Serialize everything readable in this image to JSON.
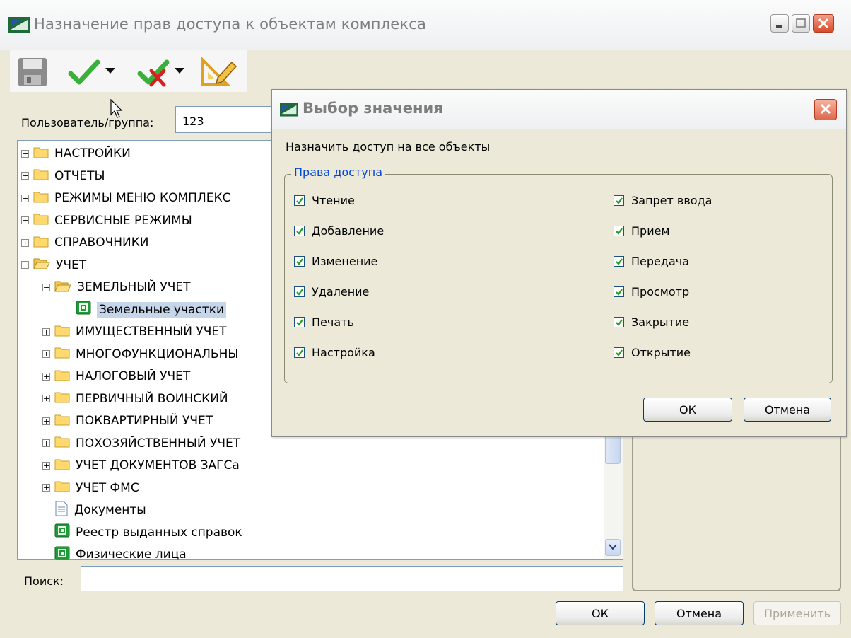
{
  "main_window": {
    "title": "Назначение прав доступа к объектам комплекса",
    "user_group_label": "Пользователь/группа:",
    "user_group_value": "123",
    "search_label": "Поиск:",
    "search_value": "",
    "buttons": {
      "ok": "ОК",
      "cancel": "Отмена",
      "apply": "Применить"
    }
  },
  "tree": [
    {
      "label": "НАСТРОЙКИ",
      "level": 0,
      "icon": "folder-icon",
      "expander": "+"
    },
    {
      "label": "ОТЧЕТЫ",
      "level": 0,
      "icon": "folder-icon",
      "expander": "+"
    },
    {
      "label": "РЕЖИМЫ МЕНЮ КОМПЛЕКС",
      "level": 0,
      "icon": "folder-icon",
      "expander": "+"
    },
    {
      "label": "СЕРВИСНЫЕ РЕЖИМЫ",
      "level": 0,
      "icon": "folder-icon",
      "expander": "+"
    },
    {
      "label": "СПРАВОЧНИКИ",
      "level": 0,
      "icon": "folder-icon",
      "expander": "+"
    },
    {
      "label": "УЧЕТ",
      "level": 0,
      "icon": "folder-open-icon",
      "expander": "−"
    },
    {
      "label": "ЗЕМЕЛЬНЫЙ УЧЕТ",
      "level": 1,
      "icon": "folder-open-icon",
      "expander": "−"
    },
    {
      "label": "Земельные участки",
      "level": 2,
      "icon": "table-icon",
      "expander": "",
      "selected": true
    },
    {
      "label": "ИМУЩЕСТВЕННЫЙ УЧЕТ",
      "level": 1,
      "icon": "folder-icon",
      "expander": "+"
    },
    {
      "label": "МНОГОФУНКЦИОНАЛЬНЫ",
      "level": 1,
      "icon": "folder-icon",
      "expander": "+"
    },
    {
      "label": "НАЛОГОВЫЙ УЧЕТ",
      "level": 1,
      "icon": "folder-icon",
      "expander": "+"
    },
    {
      "label": "ПЕРВИЧНЫЙ ВОИНСКИЙ",
      "level": 1,
      "icon": "folder-icon",
      "expander": "+"
    },
    {
      "label": "ПОКВАРТИРНЫЙ УЧЕТ",
      "level": 1,
      "icon": "folder-icon",
      "expander": "+"
    },
    {
      "label": "ПОХОЗЯЙСТВЕННЫЙ УЧЕТ",
      "level": 1,
      "icon": "folder-icon",
      "expander": "+"
    },
    {
      "label": "УЧЕТ ДОКУМЕНТОВ ЗАГСа",
      "level": 1,
      "icon": "folder-icon",
      "expander": "+"
    },
    {
      "label": "УЧЕТ ФМС",
      "level": 1,
      "icon": "folder-icon",
      "expander": "+"
    },
    {
      "label": "Документы",
      "level": 1,
      "icon": "document-icon",
      "expander": ""
    },
    {
      "label": "Реестр выданных справок",
      "level": 1,
      "icon": "table-icon",
      "expander": ""
    },
    {
      "label": "Физические лица",
      "level": 1,
      "icon": "table-icon",
      "expander": ""
    }
  ],
  "dialog": {
    "title": "Выбор значения",
    "caption": "Назначить доступ на все объекты",
    "group_label": "Права доступа",
    "rights_left": [
      "Чтение",
      "Добавление",
      "Изменение",
      "Удаление",
      "Печать",
      "Настройка"
    ],
    "rights_right": [
      "Запрет ввода",
      "Прием",
      "Передача",
      "Просмотр",
      "Закрытие",
      "Открытие"
    ],
    "buttons": {
      "ok": "ОК",
      "cancel": "Отмена"
    }
  },
  "colors": {
    "accent_blue": "#0046d5",
    "selection": "#c6d6ea",
    "check_green": "#21a121"
  }
}
